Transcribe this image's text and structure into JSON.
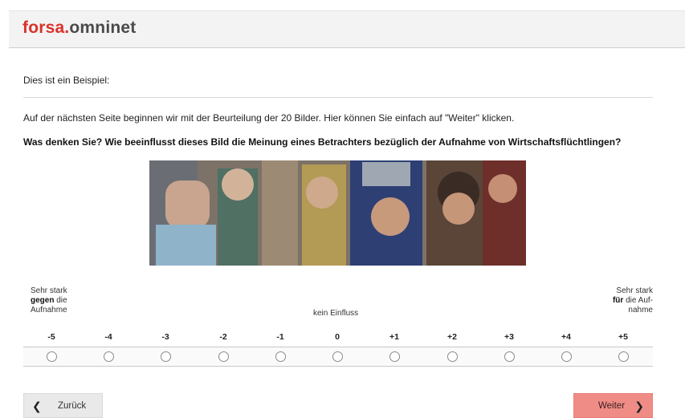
{
  "header": {
    "brand": "forsa",
    "dot": ".",
    "product": "omninet"
  },
  "intro_text": "Dies ist ein Beispiel:",
  "instruction_text": "Auf der nächsten Seite beginnen wir mit der Beurteilung der 20 Bilder. Hier können Sie einfach auf \"Weiter\" klicken.",
  "question_text": "Was denken Sie? Wie beeinflusst dieses Bild die Meinung eines Betrachters bezüglich der Aufnahme von Wirtschaftsflüchtlingen?",
  "scale": {
    "left_label": {
      "line1": "Sehr stark",
      "bold": "gegen",
      "after_bold": " die",
      "line3": "Aufnahme"
    },
    "right_label": {
      "line1": "Sehr stark",
      "bold": "für",
      "after_bold": " die Auf-",
      "line3": "nahme"
    },
    "center_label": "kein Einfluss",
    "values": [
      "-5",
      "-4",
      "-3",
      "-2",
      "-1",
      "0",
      "+1",
      "+2",
      "+3",
      "+4",
      "+5"
    ]
  },
  "nav": {
    "back_label": "Zurück",
    "next_label": "Weiter",
    "back_icon": "chevron-left-icon",
    "next_icon": "chevron-right-icon"
  },
  "colors": {
    "brand_red": "#d9322a",
    "next_button": "#f08c86"
  }
}
